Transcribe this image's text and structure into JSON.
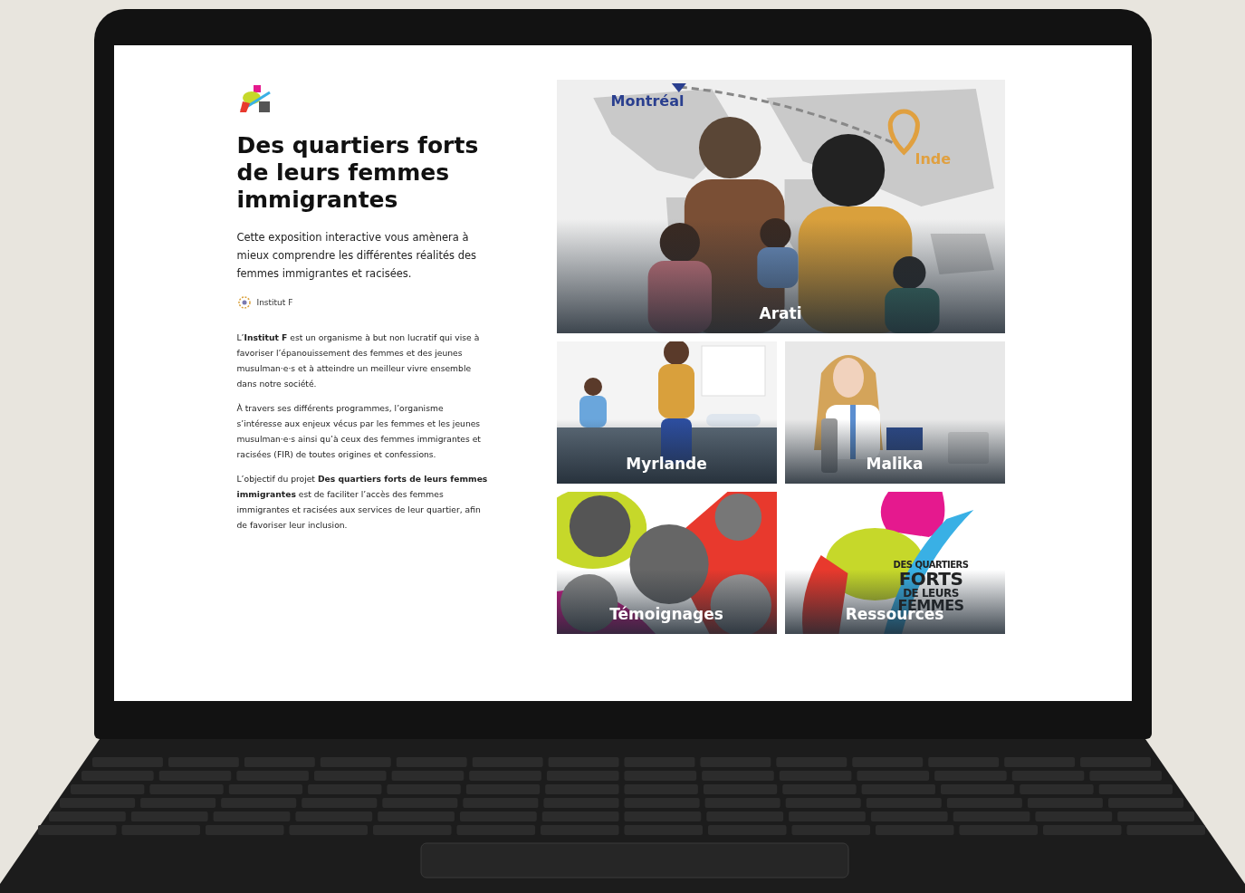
{
  "page": {
    "title": "Des quartiers forts de leurs femmes immigrantes",
    "intro": "Cette exposition interactive vous amènera à mieux comprendre les différentes réalités des femmes immigrantes et racisées.",
    "organization": "Institut F",
    "paragraphs": [
      "L’**Institut F** est un organisme à but non lucratif qui vise à favoriser l’épanouissement des femmes et des jeunes musulman·e·s et à atteindre un meilleur vivre ensemble dans notre société.",
      "À travers ses différents programmes, l’organisme s’intéresse aux enjeux vécus par les femmes et les jeunes musulman·e·s ainsi qu’à ceux des femmes immigrantes et racisées (FIR) de toutes origines et confessions.",
      "L’objectif du projet **Des quartiers forts de leurs femmes immigrantes** est de faciliter l’accès des femmes immigrantes et racisées aux services de leur quartier, afin de favoriser leur inclusion."
    ]
  },
  "tiles": [
    {
      "kind": "map-family",
      "label": "Arati",
      "map_labels": [
        "Montréal",
        "Inde"
      ]
    },
    {
      "kind": "home-scene",
      "label": "Myrlande"
    },
    {
      "kind": "lab-scene",
      "label": "Malika"
    },
    {
      "kind": "photo-collage",
      "label": "Témoignages"
    },
    {
      "kind": "logo",
      "label": "Ressources",
      "logo_lines": [
        "DES QUARTIERS",
        "FORTS",
        "DE LEURS",
        "FEMMES"
      ]
    }
  ]
}
